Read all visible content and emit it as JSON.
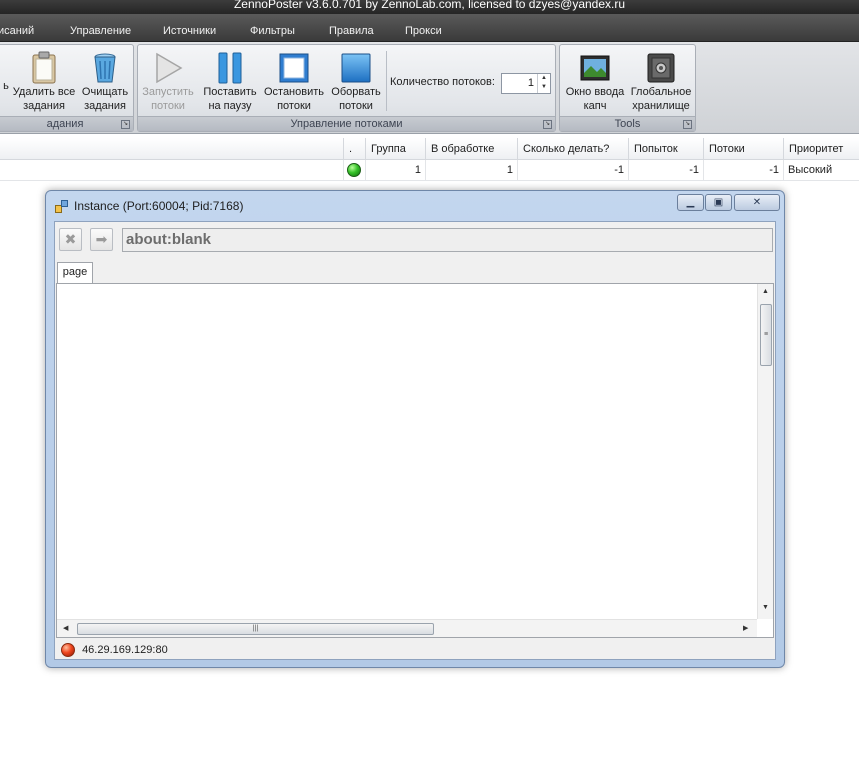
{
  "app": {
    "title": "ZennoPoster v3.6.0.701 by ZennoLab.com, licensed to dzyes@yandex.ru"
  },
  "menu": [
    {
      "name": "menu-raspisaniy",
      "label": "исаний"
    },
    {
      "name": "menu-upravlenie",
      "label": "Управление"
    },
    {
      "name": "menu-istochniki",
      "label": "Источники"
    },
    {
      "name": "menu-filtry",
      "label": "Фильтры"
    },
    {
      "name": "menu-pravila",
      "label": "Правила"
    },
    {
      "name": "menu-proksi",
      "label": "Прокси"
    }
  ],
  "ribbon": {
    "group_tasks": {
      "label": "адания",
      "partial_btn": "ь",
      "delete_all": "Удалить все\nзадания",
      "clear": "Очищать\nзадания"
    },
    "group_threads": {
      "label": "Управление потоками",
      "start": "Запустить\nпотоки",
      "pause": "Поставить\nна паузу",
      "stop": "Остановить\nпотоки",
      "abort": "Оборвать\nпотоки",
      "thread_count_label": "Количество потоков:",
      "thread_count_value": "1"
    },
    "group_tools": {
      "label": "Tools",
      "captcha": "Окно ввода\nкапч",
      "storage": "Глобальное\nхранилище"
    }
  },
  "grid": {
    "headers": [
      ".",
      "Группа",
      "В обработке",
      "Сколько делать?",
      "Попыток",
      "Потоки",
      "Приоритет"
    ],
    "row": {
      "group": "1",
      "processing": "1",
      "todo": "-1",
      "attempts": "-1",
      "threads": "-1",
      "priority": "Высокий"
    }
  },
  "instance": {
    "title": "Instance (Port:60004; Pid:7168)",
    "url": "about:blank",
    "tab": "page",
    "proxy": "46.29.169.129:80"
  }
}
